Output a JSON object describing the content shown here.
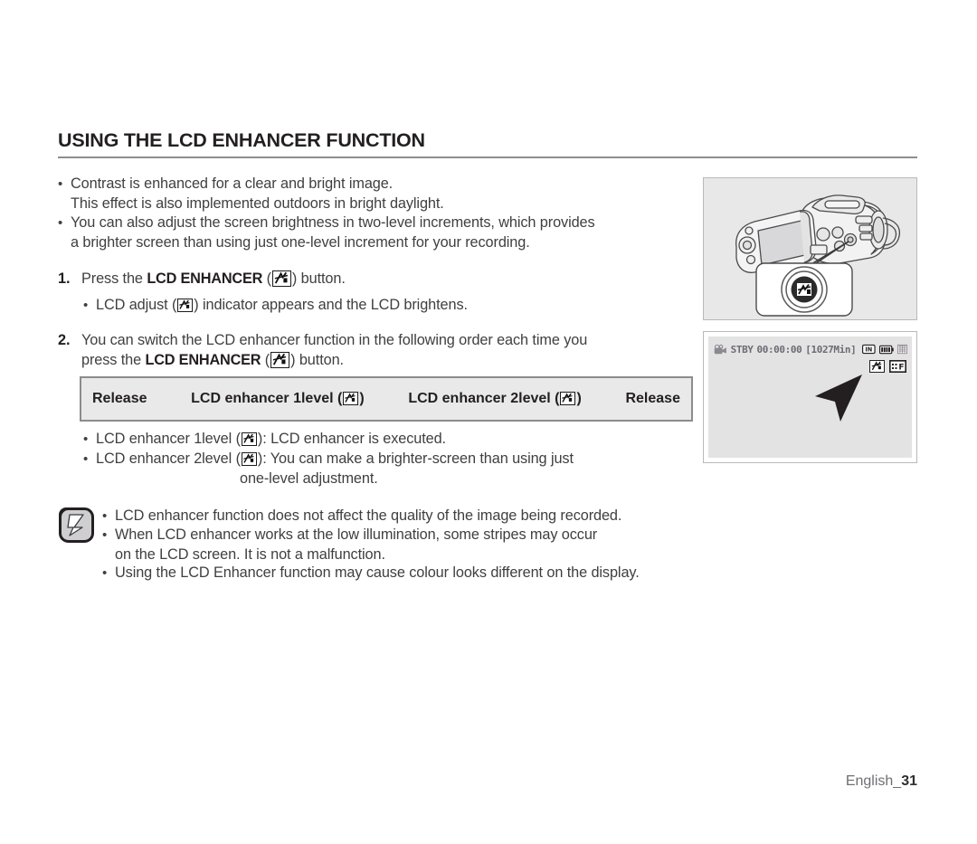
{
  "page": {
    "title": "USING THE LCD ENHANCER FUNCTION",
    "footer_label": "English_",
    "footer_page": "31"
  },
  "intro_bullets": [
    {
      "line1": "Contrast is enhanced for a clear and bright image.",
      "line2": "This effect is also implemented outdoors in bright daylight."
    },
    {
      "line1": "You can also adjust the screen brightness in two-level increments, which provides",
      "line2": "a brighter screen than using just one-level increment for your recording."
    }
  ],
  "steps": [
    {
      "number": "1.",
      "pre": "Press the ",
      "bold": "LCD ENHANCER",
      "mid": " (",
      "post": ") button.",
      "sub_bullet": {
        "pre": "LCD adjust (",
        "post": ") indicator appears and the LCD brightens."
      }
    },
    {
      "number": "2.",
      "line1": "You can switch the LCD enhancer function in the following order each time you",
      "pre2": "press the ",
      "bold2": "LCD ENHANCER",
      "mid2": " (",
      "post2": ") button."
    }
  ],
  "order_box": {
    "cells": [
      {
        "label": "Release",
        "icon": false
      },
      {
        "label_pre": "LCD enhancer 1level (",
        "label_post": ")",
        "icon": true
      },
      {
        "label_pre": "LCD enhancer 2level (",
        "label_post": ")",
        "icon": true
      },
      {
        "label": "Release",
        "icon": false
      }
    ]
  },
  "level_bullets": [
    {
      "pre": "LCD enhancer 1level (",
      "post": "): LCD enhancer is executed.",
      "cont": ""
    },
    {
      "pre": "LCD enhancer 2level (",
      "post": "): You can make a brighter-screen than using just",
      "cont": "one-level adjustment."
    }
  ],
  "notes": [
    {
      "line1": "LCD enhancer function does not affect the quality of the image being recorded.",
      "line2": ""
    },
    {
      "line1": "When LCD enhancer works at the low illumination, some stripes may occur",
      "line2": "on the LCD screen. It is not a malfunction."
    },
    {
      "line1": "Using the LCD Enhancer function may cause colour looks different on the display.",
      "line2": ""
    }
  ],
  "lcd_display": {
    "status": "STBY",
    "timecode": "00:00:00",
    "remaining": "[1027Min]",
    "storage_icon": "IN",
    "battery_icon": "battery-icon",
    "quality_icon": "quality-icon",
    "enhancer_icon": "lcd-enhancer-icon",
    "focus_icon": "manual-focus-icon"
  },
  "colors": {
    "panel_bg": "#e8e8e8",
    "box_bg": "#e9e9e9",
    "box_border": "#8c8c8f",
    "text": "#3f3f42",
    "heading": "#231f20"
  }
}
